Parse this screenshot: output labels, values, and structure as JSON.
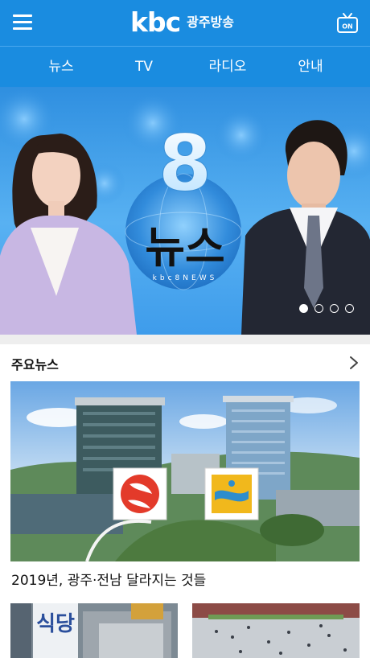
{
  "header": {
    "logo_main": "kbc",
    "logo_sub": "광주방송",
    "tv_badge": "ON"
  },
  "nav": {
    "items": [
      {
        "label": "뉴스"
      },
      {
        "label": "TV"
      },
      {
        "label": "라디오"
      },
      {
        "label": "안내"
      }
    ]
  },
  "banner": {
    "number": "8",
    "title": "뉴스",
    "sub": "kbc8NEWS",
    "slides_total": 4,
    "active_slide": 1
  },
  "section": {
    "title": "주요뉴스"
  },
  "main_news": {
    "headline": "2019년, 광주·전남 달라지는 것들"
  },
  "thumbs": [
    {
      "text": "식당"
    },
    {
      "text": ""
    }
  ],
  "colors": {
    "brand_blue": "#1a8ce0",
    "divider": "#eeeeee"
  }
}
